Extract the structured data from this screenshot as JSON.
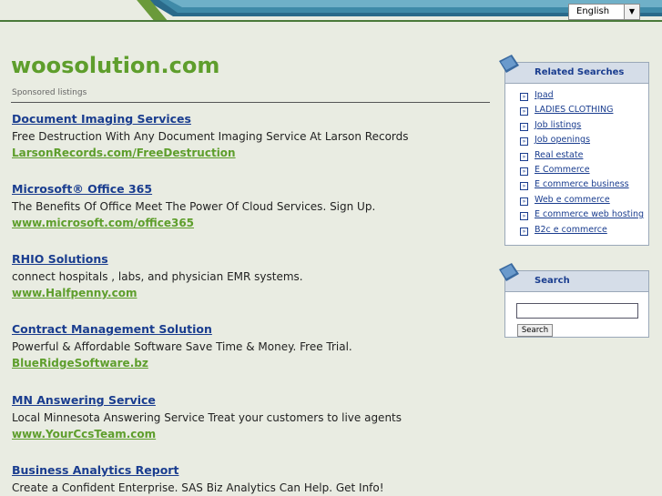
{
  "header": {
    "language_selected": "English"
  },
  "site": {
    "title": "woosolution.com",
    "sponsored_label": "Sponsored listings"
  },
  "listings": [
    {
      "title": "Document Imaging Services",
      "description": "Free Destruction With Any Document Imaging Service At Larson Records",
      "url": "LarsonRecords.com/FreeDestruction"
    },
    {
      "title": "Microsoft® Office 365",
      "description": "The Benefits Of Office Meet The Power Of Cloud Services. Sign Up.",
      "url": "www.microsoft.com/office365"
    },
    {
      "title": "RHIO Solutions",
      "description": "connect hospitals , labs, and physician EMR systems.",
      "url": "www.Halfpenny.com"
    },
    {
      "title": "Contract Management Solution",
      "description": "Powerful & Affordable Software Save Time & Money. Free Trial.",
      "url": "BlueRidgeSoftware.bz"
    },
    {
      "title": "MN Answering Service",
      "description": "Local Minnesota Answering Service Treat your customers to live agents",
      "url": "www.YourCcsTeam.com"
    },
    {
      "title": "Business Analytics Report",
      "description": "Create a Confident Enterprise. SAS Biz Analytics Can Help. Get Info!",
      "url": ""
    }
  ],
  "related": {
    "heading": "Related Searches",
    "items": [
      "Ipad",
      "LADIES CLOTHING",
      "Job listings",
      "Job openings",
      "Real estate",
      "E Commerce",
      "E commerce business",
      "Web e commerce",
      "E commerce web hosting",
      "B2c e commerce"
    ]
  },
  "search_panel": {
    "heading": "Search",
    "input_value": "",
    "button_label": "Search"
  },
  "colors": {
    "brand_green": "#5e9e2c",
    "link_blue": "#1a3d8f",
    "page_bg": "#e9ece2"
  }
}
